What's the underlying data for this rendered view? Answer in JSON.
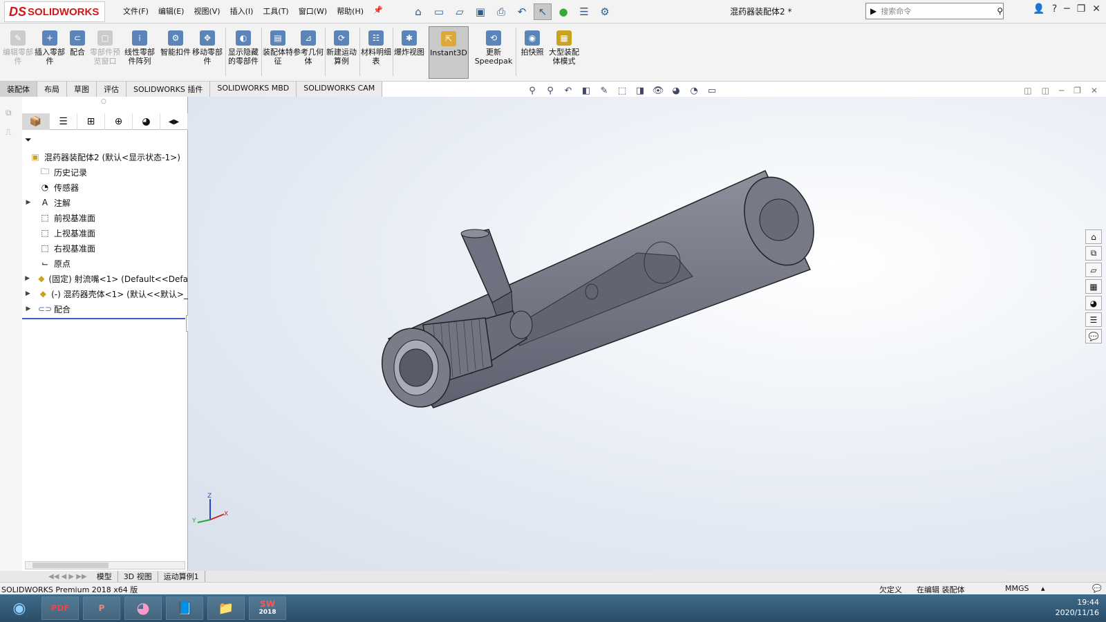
{
  "app": {
    "logo": "SOLIDWORKS",
    "logo_prefix": "DS",
    "doc_title": "混药器装配体2 *"
  },
  "menu": [
    "文件(F)",
    "编辑(E)",
    "视图(V)",
    "插入(I)",
    "工具(T)",
    "窗口(W)",
    "帮助(H)"
  ],
  "search": {
    "placeholder": "搜索命令"
  },
  "ribbon": [
    {
      "label": "编辑零部件",
      "disabled": true
    },
    {
      "label": "插入零部件",
      "disabled": false
    },
    {
      "label": "配合",
      "disabled": false
    },
    {
      "label": "零部件预览窗口",
      "disabled": true
    },
    {
      "label": "线性零部件阵列",
      "disabled": false
    },
    {
      "label": "智能扣件",
      "disabled": false
    },
    {
      "label": "移动零部件",
      "disabled": false
    },
    {
      "label": "显示隐藏的零部件",
      "disabled": false
    },
    {
      "label": "装配体特征",
      "disabled": false
    },
    {
      "label": "参考几何体",
      "disabled": false
    },
    {
      "label": "新建运动算例",
      "disabled": false
    },
    {
      "label": "材料明细表",
      "disabled": false
    },
    {
      "label": "爆炸视图",
      "disabled": false
    },
    {
      "label": "Instant3D",
      "disabled": false,
      "selected": true
    },
    {
      "label": "更新Speedpak",
      "disabled": false
    },
    {
      "label": "拍快照",
      "disabled": false
    },
    {
      "label": "大型装配体模式",
      "disabled": false
    }
  ],
  "tabs": [
    "装配体",
    "布局",
    "草图",
    "评估",
    "SOLIDWORKS 插件",
    "SOLIDWORKS MBD",
    "SOLIDWORKS CAM"
  ],
  "tree": {
    "root": "混药器装配体2 (默认<显示状态-1>)",
    "items": [
      {
        "label": "历史记录",
        "icon": "history-icon",
        "expandable": false
      },
      {
        "label": "传感器",
        "icon": "sensor-icon",
        "expandable": false
      },
      {
        "label": "注解",
        "icon": "annotation-icon",
        "expandable": true
      },
      {
        "label": "前视基准面",
        "icon": "plane-icon",
        "expandable": false
      },
      {
        "label": "上视基准面",
        "icon": "plane-icon",
        "expandable": false
      },
      {
        "label": "右视基准面",
        "icon": "plane-icon",
        "expandable": false
      },
      {
        "label": "原点",
        "icon": "origin-icon",
        "expandable": false
      },
      {
        "label": "(固定) 射流嘴<1> (Default<<Defa",
        "icon": "part-icon",
        "expandable": true
      },
      {
        "label": "(-) 混药器壳体<1> (默认<<默认>_",
        "icon": "part-icon",
        "expandable": true
      },
      {
        "label": "配合",
        "icon": "mate-icon",
        "expandable": true
      }
    ]
  },
  "bottom_tabs": [
    "模型",
    "3D 视图",
    "运动算例1"
  ],
  "status": {
    "product": "SOLIDWORKS Premium 2018 x64 版",
    "defined": "欠定义",
    "mode": "在编辑 装配体",
    "units": "MMGS"
  },
  "taskbar": {
    "apps": [
      "PDF",
      "P",
      "",
      "",
      "",
      "SW"
    ],
    "sw_year": "2018",
    "time": "19:44",
    "date": "2020/11/16"
  },
  "triad": {
    "z": "Z",
    "x": "X",
    "y": "Y"
  },
  "colors": {
    "accent": "#d01818",
    "selection": "#3a5fbf",
    "model": "#6f7180"
  }
}
